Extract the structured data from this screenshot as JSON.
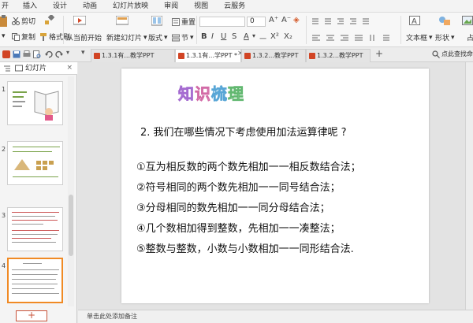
{
  "menu": {
    "first": "开",
    "items": [
      "插入",
      "设计",
      "动画",
      "幻灯片放映",
      "审阅",
      "视图",
      "云服务"
    ]
  },
  "ribbon": {
    "cut": "剪切",
    "copy": "复制",
    "format_painter": "格式刷",
    "play_from_current": "从当前开始",
    "new_slide": "新建幻灯片",
    "layout": "版式",
    "reset": "重置",
    "section": "节",
    "font_size_value": "0",
    "textbox": "文本框",
    "shape": "形状",
    "left_edge_label": "占"
  },
  "tabs": [
    {
      "label": "1.3.1有...教学PPT",
      "active": false
    },
    {
      "label": "1.3.1有...学PPT *",
      "active": true
    },
    {
      "label": "1.3.2...教学PPT",
      "active": false
    },
    {
      "label": "1.3.2...教学PPT",
      "active": false
    }
  ],
  "tabbar": {
    "add_tab": "+",
    "login_hint": "点此查找命"
  },
  "panel": {
    "tab_outline": "",
    "tab_slides": "幻灯片",
    "close": "×",
    "numbers": [
      "1",
      "2",
      "3",
      "4"
    ],
    "add_button": "+"
  },
  "slide": {
    "title_chars": [
      "知",
      "识",
      "梳",
      "理"
    ],
    "question": "2. 我们在哪些情况下考虑使用加法运算律呢 ?",
    "items": [
      "①互为相反数的两个数先相加一一相反数结合法；",
      "②符号相同的两个数先相加一一同号结合法；",
      "③分母相同的数先相加一一同分母结合法；",
      "④几个数相加得到整数，先相加一一凑整法；",
      "⑤整数与整数，小数与小数相加一一同形结合法."
    ]
  },
  "status": {
    "notes_hint": "单击此处添加备注"
  },
  "colors": {
    "accent": "#f08a24",
    "doc_icon": "#d14424"
  }
}
